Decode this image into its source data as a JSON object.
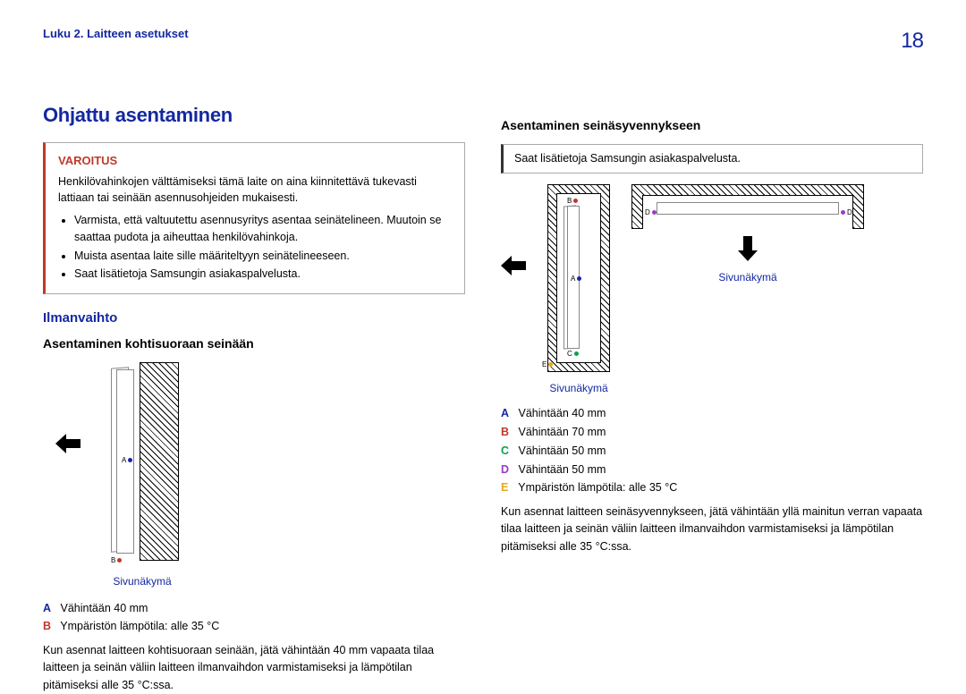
{
  "header": {
    "chapter": "Luku 2. Laitteen asetukset",
    "page": "18"
  },
  "left": {
    "title": "Ohjattu asentaminen",
    "warning": {
      "label": "VAROITUS",
      "body": "Henkilövahinkojen välttämiseksi tämä laite on aina kiinnitettävä tukevasti lattiaan tai seinään asennusohjeiden mukaisesti.",
      "bullets": [
        "Varmista, että valtuutettu asennusyritys asentaa seinätelineen. Muutoin se saattaa pudota ja aiheuttaa henkilövahinkoja.",
        "Muista asentaa laite sille määriteltyyn seinätelineeseen.",
        "Saat lisätietoja Samsungin asiakaspalvelusta."
      ]
    },
    "ventilation": {
      "heading": "Ilmanvaihto",
      "sub": "Asentaminen kohtisuoraan seinään",
      "sideview": "Sivunäkymä",
      "legend": {
        "a_key": "A",
        "a_text": "Vähintään 40 mm",
        "b_key": "B",
        "b_text": "Ympäristön lämpötila: alle 35 °C"
      },
      "para": "Kun asennat laitteen kohtisuoraan seinään, jätä vähintään 40 mm vapaata tilaa laitteen ja seinän väliin laitteen ilmanvaihdon varmistamiseksi ja lämpötilan pitämiseksi alle 35 °C:ssa."
    }
  },
  "right": {
    "sub": "Asentaminen seinäsyvennykseen",
    "info": "Saat lisätietoja Samsungin asiakaspalvelusta.",
    "sideview": "Sivunäkymä",
    "legend": {
      "a_key": "A",
      "a_text": "Vähintään 40 mm",
      "b_key": "B",
      "b_text": "Vähintään 70 mm",
      "c_key": "C",
      "c_text": "Vähintään 50 mm",
      "d_key": "D",
      "d_text": "Vähintään 50 mm",
      "e_key": "E",
      "e_text": "Ympäristön lämpötila: alle 35 °C"
    },
    "para": "Kun asennat laitteen seinäsyvennykseen, jätä vähintään yllä mainitun verran vapaata tilaa laitteen ja seinän väliin laitteen ilmanvaihdon varmistamiseksi ja lämpötilan pitämiseksi alle 35 °C:ssa."
  }
}
